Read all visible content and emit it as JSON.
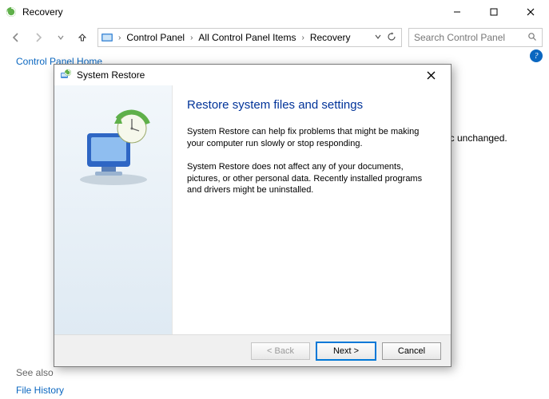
{
  "window": {
    "title": "Recovery",
    "search_placeholder": "Search Control Panel"
  },
  "breadcrumb": {
    "seg1": "Control Panel",
    "seg2": "All Control Panel Items",
    "seg3": "Recovery"
  },
  "left": {
    "home": "Control Panel Home",
    "see_also": "See also",
    "file_history": "File History"
  },
  "background_hint_tail": "ic unchanged.",
  "dialog": {
    "title": "System Restore",
    "heading": "Restore system files and settings",
    "para1": "System Restore can help fix problems that might be making your computer run slowly or stop responding.",
    "para2": "System Restore does not affect any of your documents, pictures, or other personal data. Recently installed programs and drivers might be uninstalled.",
    "buttons": {
      "back": "< Back",
      "next": "Next >",
      "cancel": "Cancel"
    }
  }
}
